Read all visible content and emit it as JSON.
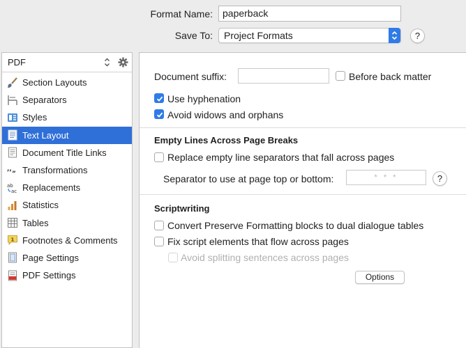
{
  "header": {
    "format_name_label": "Format Name:",
    "format_name_value": "paperback",
    "save_to_label": "Save To:",
    "save_to_value": "Project Formats",
    "help": "?"
  },
  "sidebar": {
    "selected_format": "PDF",
    "items": [
      {
        "label": "Section Layouts",
        "icon": "brush-icon"
      },
      {
        "label": "Separators",
        "icon": "separator-icon"
      },
      {
        "label": "Styles",
        "icon": "styles-icon"
      },
      {
        "label": "Text Layout",
        "icon": "text-layout-icon",
        "selected": true
      },
      {
        "label": "Document Title Links",
        "icon": "document-icon"
      },
      {
        "label": "Transformations",
        "icon": "quotes-icon"
      },
      {
        "label": "Replacements",
        "icon": "replace-icon"
      },
      {
        "label": "Statistics",
        "icon": "bar-chart-icon"
      },
      {
        "label": "Tables",
        "icon": "table-icon"
      },
      {
        "label": "Footnotes & Comments",
        "icon": "footnote-icon"
      },
      {
        "label": "Page Settings",
        "icon": "page-icon"
      },
      {
        "label": "PDF Settings",
        "icon": "pdf-icon"
      }
    ]
  },
  "main": {
    "document_suffix_label": "Document suffix:",
    "document_suffix_value": "",
    "before_back_matter_label": "Before back matter",
    "before_back_matter_checked": false,
    "use_hyphenation_label": "Use hyphenation",
    "use_hyphenation_checked": true,
    "avoid_widows_label": "Avoid widows and orphans",
    "avoid_widows_checked": true,
    "empty_lines": {
      "heading": "Empty Lines Across Page Breaks",
      "replace_label": "Replace empty line separators that fall across pages",
      "replace_checked": false,
      "separator_label": "Separator to use at page top or bottom:",
      "separator_value": "* * *",
      "help": "?"
    },
    "scriptwriting": {
      "heading": "Scriptwriting",
      "convert_label": "Convert Preserve Formatting blocks to dual dialogue tables",
      "convert_checked": false,
      "fix_label": "Fix script elements that flow across pages",
      "fix_checked": false,
      "avoid_splitting_label": "Avoid splitting sentences across pages",
      "avoid_splitting_checked": false,
      "avoid_splitting_disabled": true,
      "options_button": "Options"
    }
  },
  "colors": {
    "accent": "#2f7be8",
    "selection": "#2f6fd8",
    "window_bg": "#ececec"
  }
}
